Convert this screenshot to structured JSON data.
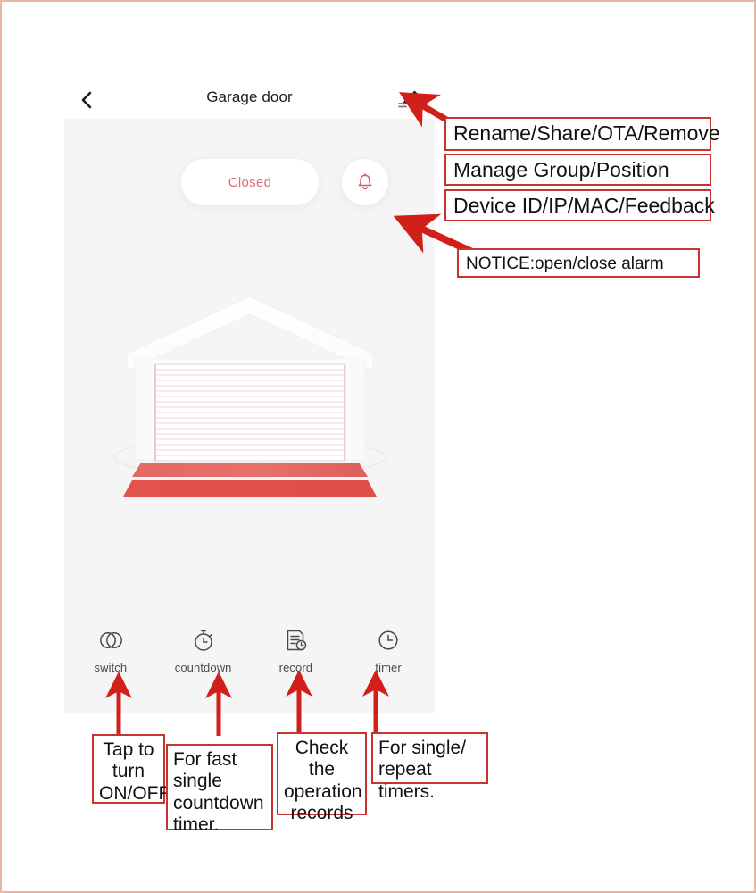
{
  "app": {
    "title": "Garage door",
    "back_icon": "chevron-left-icon",
    "edit_icon": "pencil-edit-icon",
    "status_label": "Closed",
    "bell_icon": "bell-icon",
    "illustration": "garage-door-closed-illustration"
  },
  "toolbar": {
    "items": [
      {
        "label": "switch",
        "icon": "switch-toggle-icon"
      },
      {
        "label": "countdown",
        "icon": "stopwatch-icon"
      },
      {
        "label": "record",
        "icon": "document-clock-icon"
      },
      {
        "label": "timer",
        "icon": "clock-icon"
      }
    ]
  },
  "annotations": {
    "menu": [
      {
        "text": "Rename/Share/OTA/Remove"
      },
      {
        "text": "Manage Group/Position"
      },
      {
        "text": "Device ID/IP/MAC/Feedback"
      }
    ],
    "notice": {
      "text": "NOTICE:open/close alarm"
    },
    "tools": [
      {
        "text": "Tap to turn ON/OFF."
      },
      {
        "text": "For fast single countdown timer."
      },
      {
        "text": "Check the operation records"
      },
      {
        "text": "For single/ repeat timers."
      }
    ]
  },
  "colors": {
    "accent_red": "#c7342f",
    "status_pink": "#e06a78",
    "door_red": "#e2615c",
    "page_border": "#e8b7a4",
    "app_bg": "#f5f5f5"
  }
}
